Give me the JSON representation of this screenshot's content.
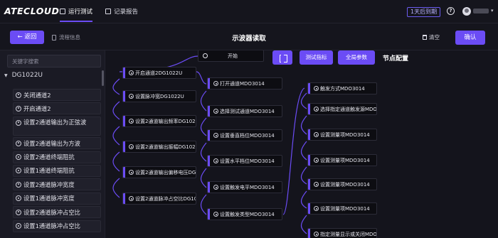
{
  "header": {
    "logo": "ATECLOUD",
    "nav": [
      {
        "label": "运行测试",
        "active": true
      },
      {
        "label": "记录报告",
        "active": false
      }
    ],
    "trial_badge": "1天后到期",
    "help": "?"
  },
  "toolbar": {
    "back_label": "返回",
    "flow_info_label": "流程信息",
    "title": "示波器读取",
    "clear_label": "清空",
    "confirm_label": "确认"
  },
  "sidebar": {
    "search_placeholder": "关键字搜索",
    "group": "DG1022U",
    "items": [
      "关闭通道2",
      "开启通道2",
      "设置2通道输出为正弦波",
      "设置2通道输出为方波",
      "设置2通道终端阻抗",
      "设置1通道终端阻抗",
      "设置2通道脉冲宽度",
      "设置1通道脉冲宽度",
      "设置2通道脉冲占空比",
      "设置1通道脉冲占空比"
    ]
  },
  "canvas": {
    "test_metrics_label": "测试指标",
    "global_params_label": "全局参数",
    "start_label": "开始",
    "column1": [
      "开启通道2DG1022U",
      "设置脉冲宽DG1022U",
      "设置2通道输出频率DG1022U",
      "设置2通道输出振幅DG1022U",
      "设置2通道输出偏移电压DG1022U",
      "设置2通道脉冲占空比DG1022U"
    ],
    "column2": [
      "打开通道MDO3014",
      "选择测试通道MDO3014",
      "设置垂直档位MDO3014",
      "设置水平档位MDO3014",
      "设置触发电平MDO3014",
      "设置触发类型MDO3014"
    ],
    "column3": [
      "触发方式MDO3014",
      "选择指定通道触发源MDO3014",
      "设置测量项MDO3014",
      "设置测量项MDO3014",
      "设置测量项MDO3014",
      "设置测量项MDO3014",
      "指定测量显示或关闭MDO3014"
    ]
  },
  "right_panel": {
    "title": "节点配置"
  },
  "colors": {
    "accent": "#6b4cf5",
    "background": "#14141c",
    "panel": "#1a1a24"
  }
}
